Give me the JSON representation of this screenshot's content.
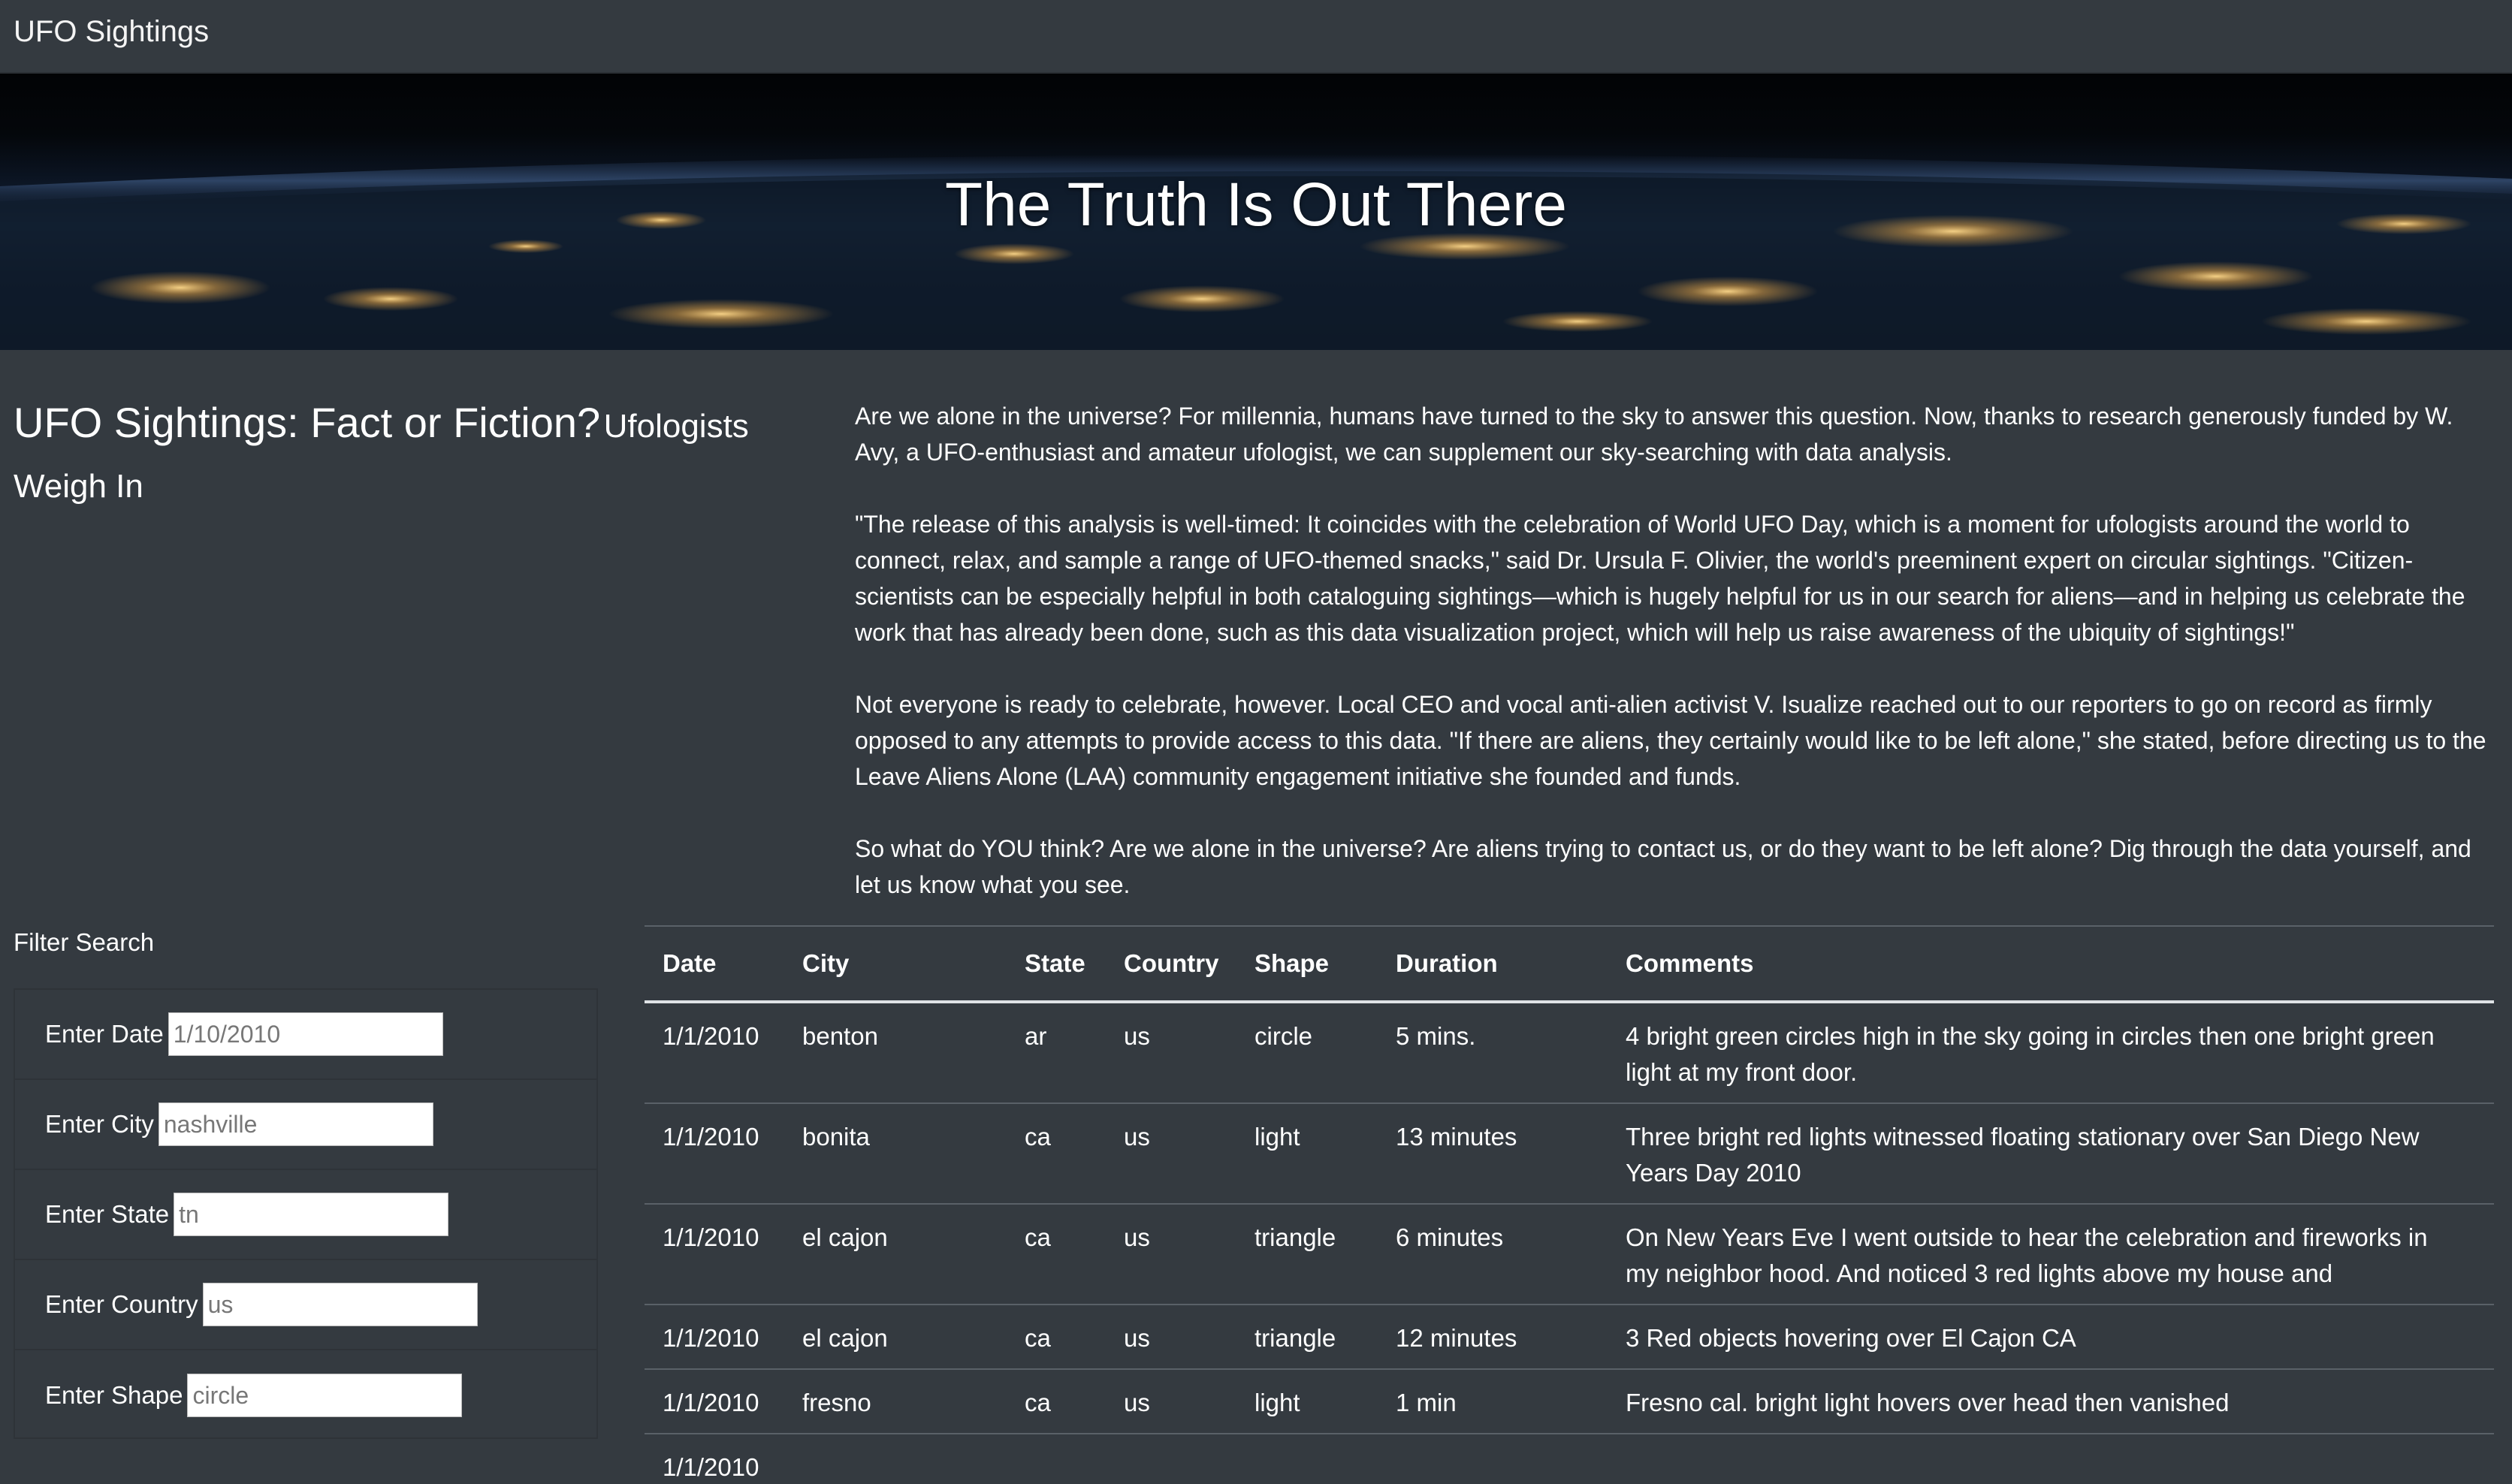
{
  "navbar": {
    "brand": "UFO Sightings"
  },
  "hero": {
    "title": "The Truth Is Out There"
  },
  "headline": {
    "main": "UFO Sightings: Fact or Fiction?",
    "sub": "Ufologists Weigh In"
  },
  "article": {
    "paragraphs": [
      "Are we alone in the universe? For millennia, humans have turned to the sky to answer this question. Now, thanks to research generously funded by W. Avy, a UFO-enthusiast and amateur ufologist, we can supplement our sky-searching with data analysis.",
      "\"The release of this analysis is well-timed: It coincides with the celebration of World UFO Day, which is a moment for ufologists around the world to connect, relax, and sample a range of UFO-themed snacks,\" said Dr. Ursula F. Olivier, the world's preeminent expert on circular sightings. \"Citizen-scientists can be especially helpful in both cataloguing sightings—which is hugely helpful for us in our search for aliens—and in helping us celebrate the work that has already been done, such as this data visualization project, which will help us raise awareness of the ubiquity of sightings!\"",
      "Not everyone is ready to celebrate, however. Local CEO and vocal anti-alien activist V. Isualize reached out to our reporters to go on record as firmly opposed to any attempts to provide access to this data. \"If there are aliens, they certainly would like to be left alone,\" she stated, before directing us to the Leave Aliens Alone (LAA) community engagement initiative she founded and funds.",
      "So what do YOU think? Are we alone in the universe? Are aliens trying to contact us, or do they want to be left alone? Dig through the data yourself, and let us know what you see."
    ]
  },
  "filters": {
    "heading": "Filter Search",
    "items": [
      {
        "label": "Enter Date",
        "placeholder": "1/10/2010",
        "value": ""
      },
      {
        "label": "Enter City",
        "placeholder": "nashville",
        "value": ""
      },
      {
        "label": "Enter State",
        "placeholder": "tn",
        "value": ""
      },
      {
        "label": "Enter Country",
        "placeholder": "us",
        "value": ""
      },
      {
        "label": "Enter Shape",
        "placeholder": "circle",
        "value": ""
      }
    ]
  },
  "table": {
    "headers": [
      "Date",
      "City",
      "State",
      "Country",
      "Shape",
      "Duration",
      "Comments"
    ],
    "rows": [
      [
        "1/1/2010",
        "benton",
        "ar",
        "us",
        "circle",
        "5 mins.",
        "4 bright green circles high in the sky going in circles then one bright green light at my front door."
      ],
      [
        "1/1/2010",
        "bonita",
        "ca",
        "us",
        "light",
        "13 minutes",
        "Three bright red lights witnessed floating stationary over San Diego New Years Day 2010"
      ],
      [
        "1/1/2010",
        "el cajon",
        "ca",
        "us",
        "triangle",
        "6 minutes",
        "On New Years Eve I went outside to hear the celebration and fireworks in my neighbor hood. And noticed 3 red lights above my house and"
      ],
      [
        "1/1/2010",
        "el cajon",
        "ca",
        "us",
        "triangle",
        "12 minutes",
        "3 Red objects hovering over El Cajon CA"
      ],
      [
        "1/1/2010",
        "fresno",
        "ca",
        "us",
        "light",
        "1 min",
        "Fresno cal. bright light hovers over head then vanished"
      ],
      [
        "1/1/2010",
        "",
        "",
        "",
        "",
        "",
        ""
      ]
    ]
  },
  "colors": {
    "background": "#343a40",
    "text": "#ffffff",
    "divider": "#5a6168"
  }
}
